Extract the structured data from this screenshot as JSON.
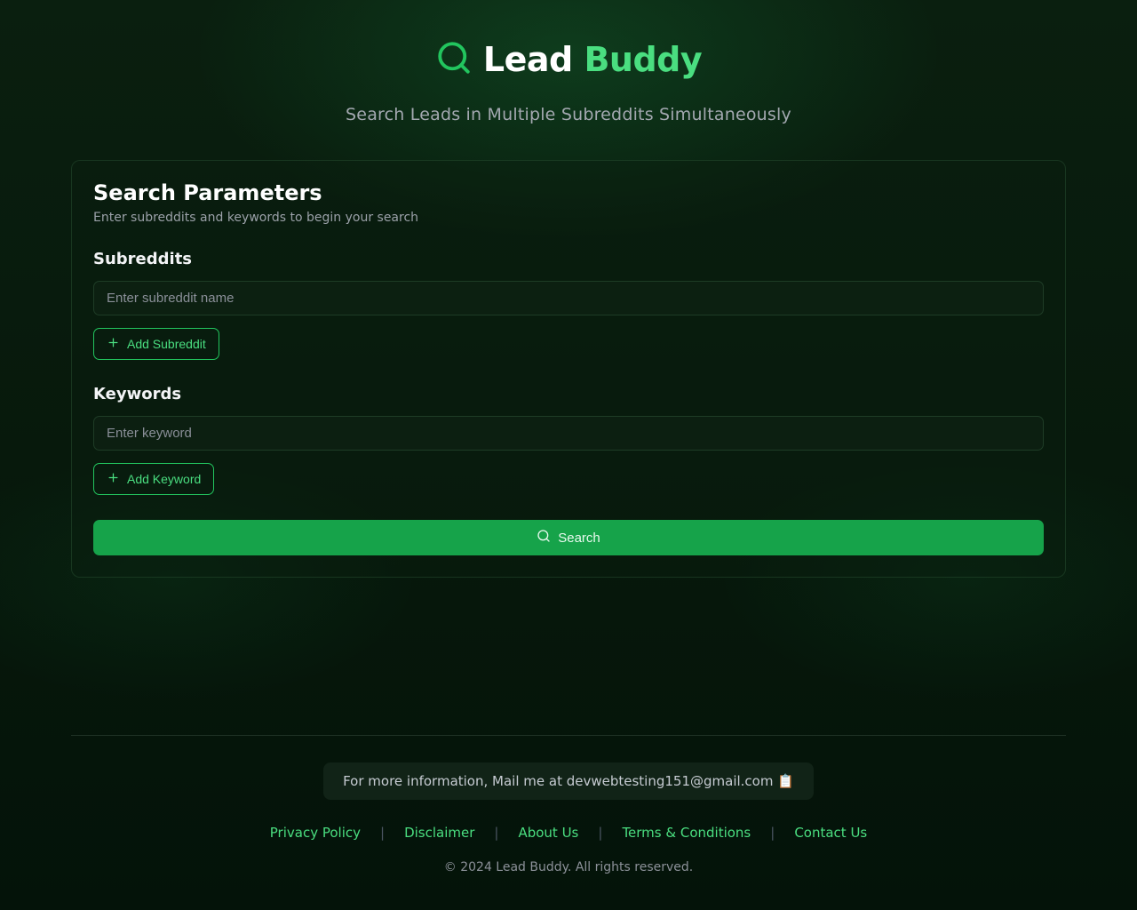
{
  "header": {
    "logo_lead": "Lead",
    "logo_buddy": "Buddy",
    "tagline": "Search Leads in Multiple Subreddits Simultaneously"
  },
  "card": {
    "title": "Search Parameters",
    "subtitle": "Enter subreddits and keywords to begin your search"
  },
  "subreddits": {
    "label": "Subreddits",
    "placeholder": "Enter subreddit name",
    "add_label": "Add Subreddit"
  },
  "keywords": {
    "label": "Keywords",
    "placeholder": "Enter keyword",
    "add_label": "Add Keyword"
  },
  "search": {
    "button_label": "Search"
  },
  "footer": {
    "mail_text": "For more information, Mail me at devwebtesting151@gmail.com 📋",
    "links": [
      "Privacy Policy",
      "Disclaimer",
      "About Us",
      "Terms & Conditions",
      "Contact Us"
    ],
    "copyright": "© 2024 Lead Buddy. All rights reserved."
  }
}
